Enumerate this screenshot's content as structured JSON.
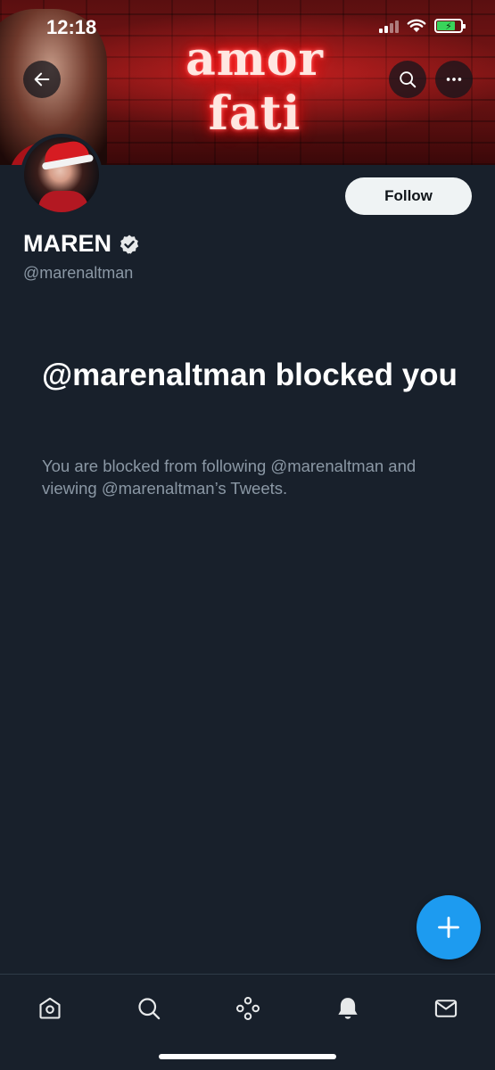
{
  "status_bar": {
    "time": "12:18"
  },
  "banner": {
    "neon_text": "amor fati"
  },
  "header_actions": {
    "back_icon": "arrow-left-icon",
    "search_icon": "search-icon",
    "more_icon": "more-horizontal-icon"
  },
  "profile": {
    "follow_label": "Follow",
    "display_name": "MAREN",
    "verified_icon": "verified-badge-icon",
    "handle": "@marenaltman"
  },
  "blocked": {
    "title": "@marenaltman blocked you",
    "description": "You are blocked from following @marenaltman and viewing @marenaltman’s Tweets."
  },
  "fab": {
    "icon": "plus-icon"
  },
  "tab_bar": {
    "items": [
      {
        "icon": "home-icon"
      },
      {
        "icon": "search-icon"
      },
      {
        "icon": "spaces-icon"
      },
      {
        "icon": "notifications-bell-icon"
      },
      {
        "icon": "messages-envelope-icon"
      }
    ]
  },
  "colors": {
    "background": "#18202b",
    "accent": "#1d9bf0",
    "secondary_text": "#8b98a5",
    "follow_button_bg": "#eff3f4"
  }
}
